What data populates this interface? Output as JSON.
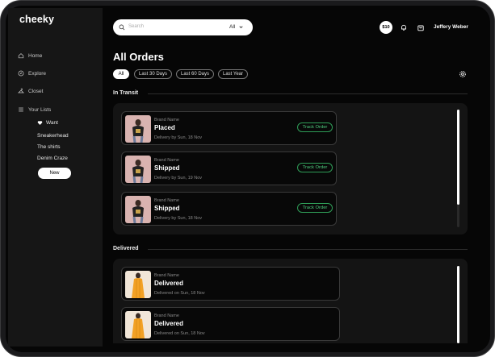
{
  "app": {
    "logo": "cheeky"
  },
  "sidebar": {
    "nav": [
      {
        "label": "Home",
        "icon": "home-icon"
      },
      {
        "label": "Explore",
        "icon": "compass-icon"
      },
      {
        "label": "Closet",
        "icon": "hanger-icon"
      },
      {
        "label": "Your Lists",
        "icon": "list-icon"
      }
    ],
    "lists": [
      {
        "label": "Want",
        "icon": "heart-icon"
      },
      {
        "label": "Sneakerhead"
      },
      {
        "label": "The shirts"
      },
      {
        "label": "Denim Craze"
      }
    ],
    "new_button": "New"
  },
  "topbar": {
    "search_placeholder": "Search",
    "search_filter": "All",
    "balance": "$10",
    "user_name": "Jeffery Weber"
  },
  "main": {
    "title": "All Orders",
    "filters": [
      "All",
      "Last 30 Days",
      "Last 60 Days",
      "Last Year"
    ],
    "active_filter": "All",
    "sections": {
      "in_transit": {
        "label": "In Transit",
        "orders": [
          {
            "brand": "Brand Name",
            "status": "Placed",
            "delivery": "Delivery by Sun, 18 Nov",
            "action": "Track Order"
          },
          {
            "brand": "Brand Name",
            "status": "Shipped",
            "delivery": "Delivery by Sun, 19 Nov",
            "action": "Track Order"
          },
          {
            "brand": "Brand Name",
            "status": "Shipped",
            "delivery": "Delivery by Sun, 18 Nov",
            "action": "Track Order"
          }
        ]
      },
      "delivered": {
        "label": "Delivered",
        "orders": [
          {
            "brand": "Brand Name",
            "status": "Delivered",
            "delivery": "Delivered on Sun, 18 Nov"
          },
          {
            "brand": "Brand Name",
            "status": "Delivered",
            "delivery": "Delivered on Sun, 18 Nov"
          }
        ]
      }
    }
  },
  "colors": {
    "background": "#060606",
    "sidebar": "#161616",
    "panel": "#141414",
    "track_accent": "#4fce7f"
  }
}
